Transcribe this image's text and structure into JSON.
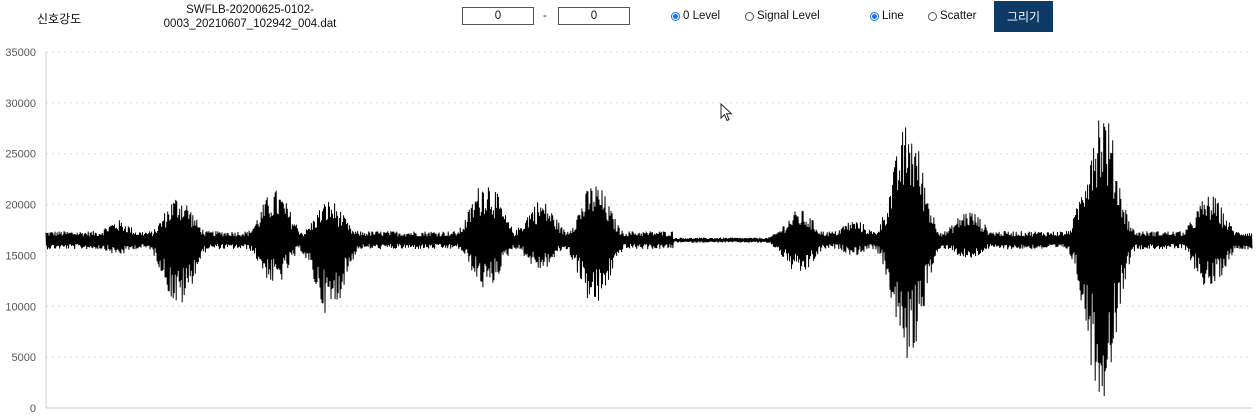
{
  "toolbar": {
    "title": "신호강도",
    "file_name_line1": "SWFLB-20200625-0102-",
    "file_name_line2": "0003_20210607_102942_004.dat",
    "range_start": "0",
    "range_end": "0",
    "range_separator": "-",
    "level_options": [
      {
        "label": "0 Level",
        "checked": true
      },
      {
        "label": "Signal Level",
        "checked": false
      }
    ],
    "mode_options": [
      {
        "label": "Line",
        "checked": true
      },
      {
        "label": "Scatter",
        "checked": false
      }
    ],
    "draw_label": "그리기"
  },
  "colors": {
    "button_bg": "#0e3a66",
    "radio_selected": "#1a73e8",
    "signal_line": "#000000",
    "grid": "#dddddd"
  },
  "icons": {
    "cursor": "mouse-pointer-icon"
  },
  "chart_data": {
    "type": "line",
    "title": "",
    "xlabel": "",
    "ylabel": "",
    "ylim": [
      0,
      35000
    ],
    "yticks": [
      0,
      5000,
      10000,
      15000,
      20000,
      25000,
      30000,
      35000
    ],
    "grid": "horizontal dashed",
    "baseline": 16500,
    "series": [
      {
        "bursts": [
          {
            "x": 0.06,
            "min": 15000,
            "max": 18500
          },
          {
            "x": 0.11,
            "min": 9800,
            "max": 21000
          },
          {
            "x": 0.19,
            "min": 12000,
            "max": 21500
          },
          {
            "x": 0.235,
            "min": 9000,
            "max": 20500
          },
          {
            "x": 0.365,
            "min": 11500,
            "max": 22700
          },
          {
            "x": 0.41,
            "min": 13500,
            "max": 20500
          },
          {
            "x": 0.455,
            "min": 9800,
            "max": 22200
          },
          {
            "x": 0.625,
            "min": 13000,
            "max": 19500
          },
          {
            "x": 0.67,
            "min": 15000,
            "max": 18500
          },
          {
            "x": 0.715,
            "min": 4500,
            "max": 28200
          },
          {
            "x": 0.765,
            "min": 14500,
            "max": 19500
          },
          {
            "x": 0.875,
            "min": 800,
            "max": 30100
          },
          {
            "x": 0.965,
            "min": 11600,
            "max": 21000
          }
        ]
      }
    ]
  }
}
